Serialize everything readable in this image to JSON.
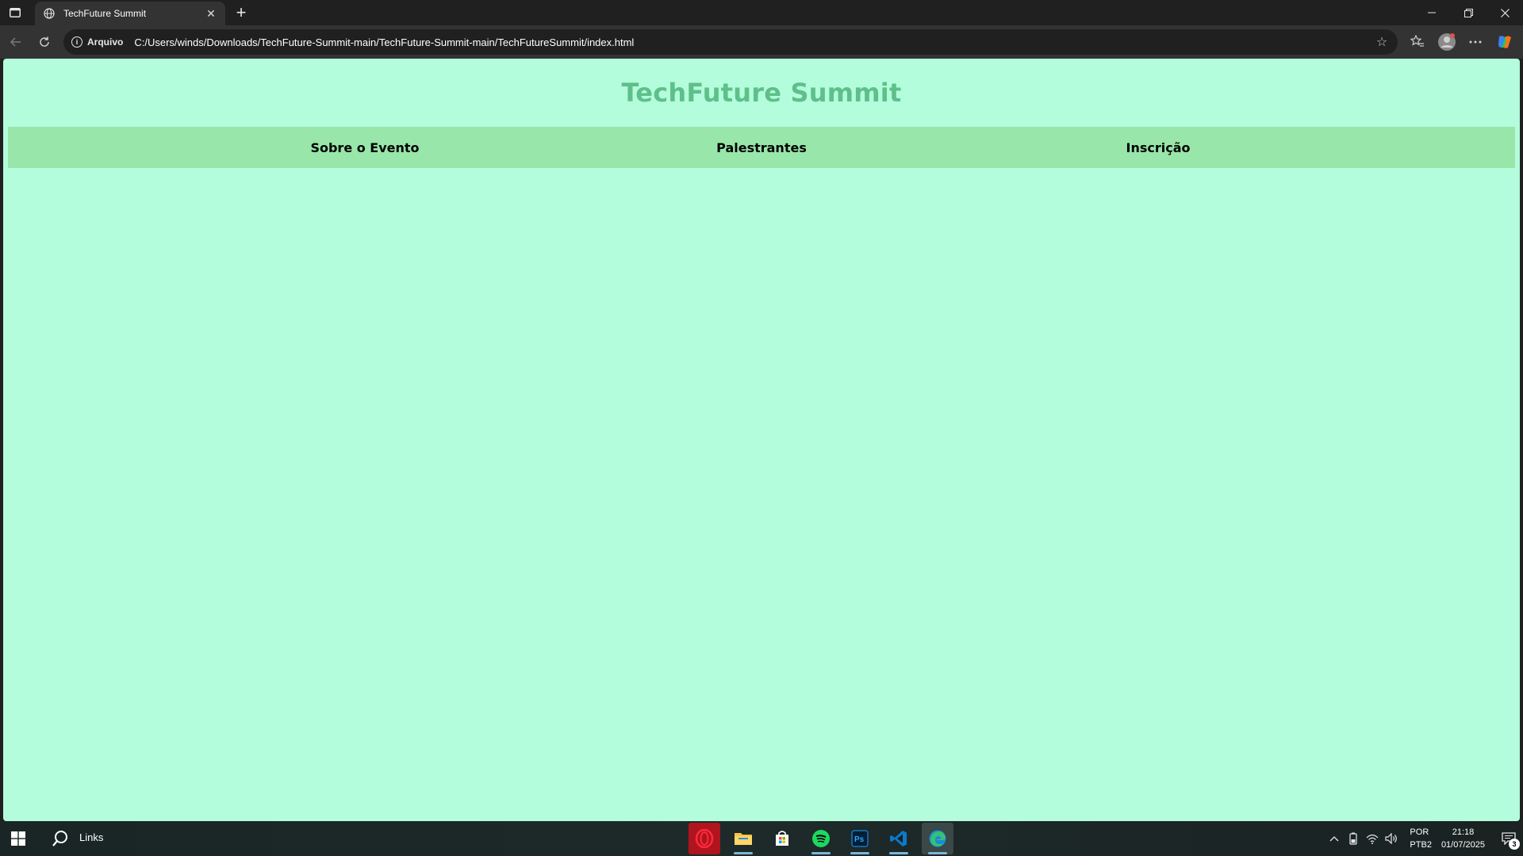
{
  "browser": {
    "tab": {
      "title": "TechFuture Summit"
    },
    "address_bar": {
      "security_label": "Arquivo",
      "url": "C:/Users/winds/Downloads/TechFuture-Summit-main/TechFuture-Summit-main/TechFutureSummit/index.html"
    }
  },
  "page": {
    "title": "TechFuture Summit",
    "nav": [
      "Sobre o Evento",
      "Palestrantes",
      "Inscrição"
    ],
    "colors": {
      "background": "#b3fddc",
      "nav_background": "#98e6aa",
      "title_color": "#5fbf8a"
    }
  },
  "taskbar": {
    "search_label": "Links",
    "apps": [
      "opera-icon",
      "file-explorer-icon",
      "microsoft-store-icon",
      "spotify-icon",
      "photoshop-icon",
      "vscode-icon",
      "edge-icon"
    ],
    "tray": {
      "lang_line1": "POR",
      "lang_line2": "PTB2",
      "time": "21:18",
      "date": "01/07/2025",
      "notification_count": "3"
    }
  }
}
